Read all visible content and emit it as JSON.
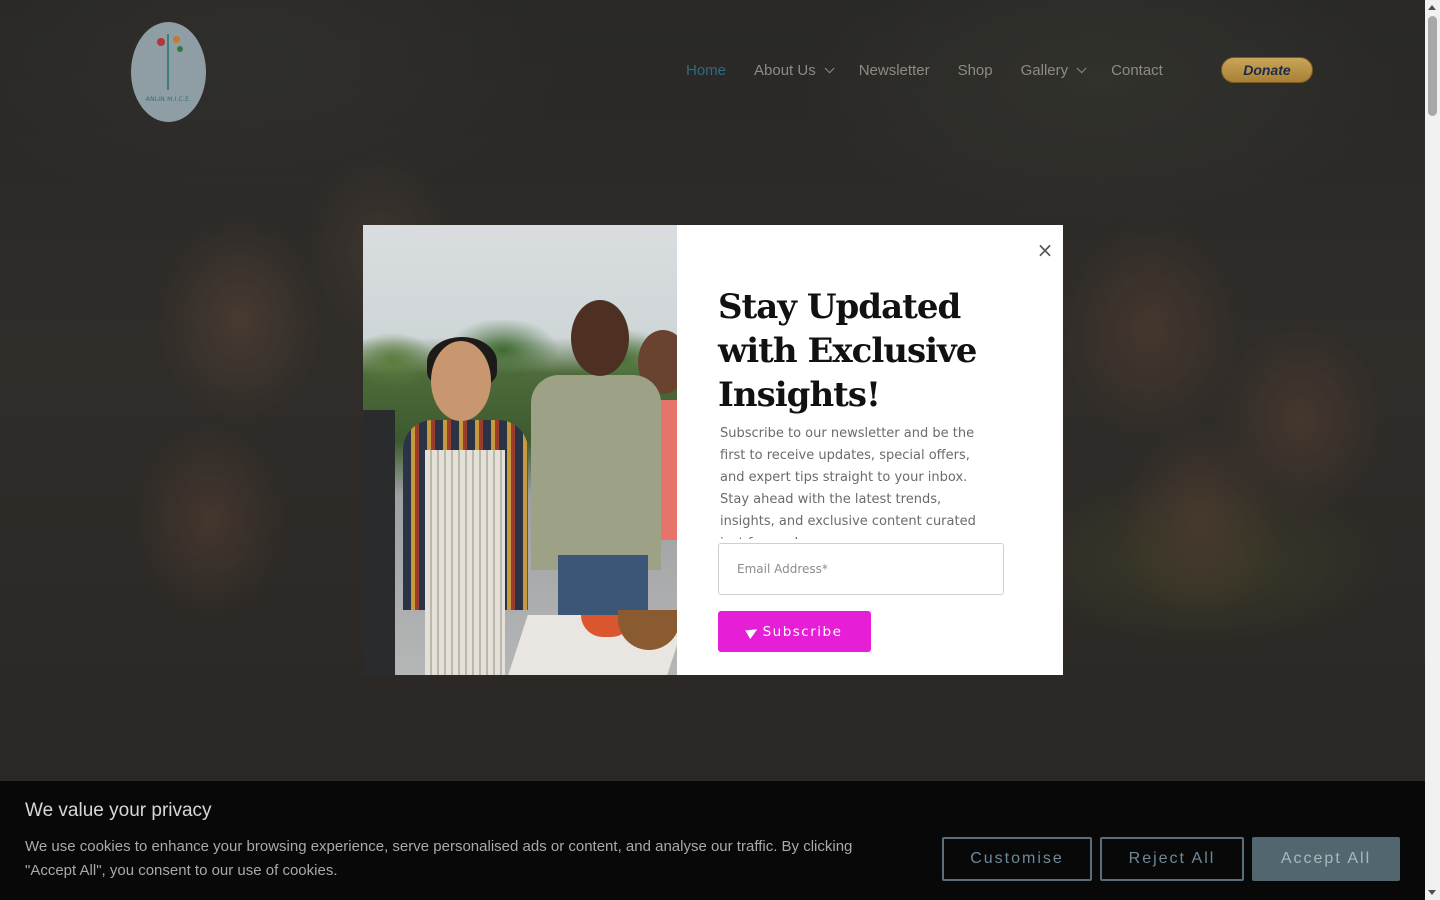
{
  "header": {
    "logo_text": "ANLIN M.I.C.E.",
    "nav": [
      {
        "label": "Home",
        "active": true,
        "has_dropdown": false
      },
      {
        "label": "About Us",
        "active": false,
        "has_dropdown": true
      },
      {
        "label": "Newsletter",
        "active": false,
        "has_dropdown": false
      },
      {
        "label": "Shop",
        "active": false,
        "has_dropdown": false
      },
      {
        "label": "Gallery",
        "active": false,
        "has_dropdown": true
      },
      {
        "label": "Contact",
        "active": false,
        "has_dropdown": false
      }
    ],
    "donate_label": "Donate"
  },
  "modal": {
    "title": "Stay Updated with Exclusive Insights!",
    "description": "Subscribe to our newsletter and be the first to receive updates, special offers, and expert tips straight to your inbox. Stay ahead with the latest trends, insights, and exclusive content curated just for you!",
    "email_placeholder": "Email Address*",
    "subscribe_label": "Subscribe",
    "close_glyph": "×"
  },
  "cookie": {
    "title": "We value your privacy",
    "text": "We use cookies to enhance your browsing experience, serve personalised ads or content, and analyse our traffic. By clicking \"Accept All\", you consent to our use of cookies.",
    "customise_label": "Customise",
    "reject_label": "Reject All",
    "accept_label": "Accept All"
  },
  "colors": {
    "nav_active": "#2f6b80",
    "subscribe_bg": "#e61fd6",
    "cookie_bg": "#080808",
    "accept_bg": "#52666f"
  }
}
